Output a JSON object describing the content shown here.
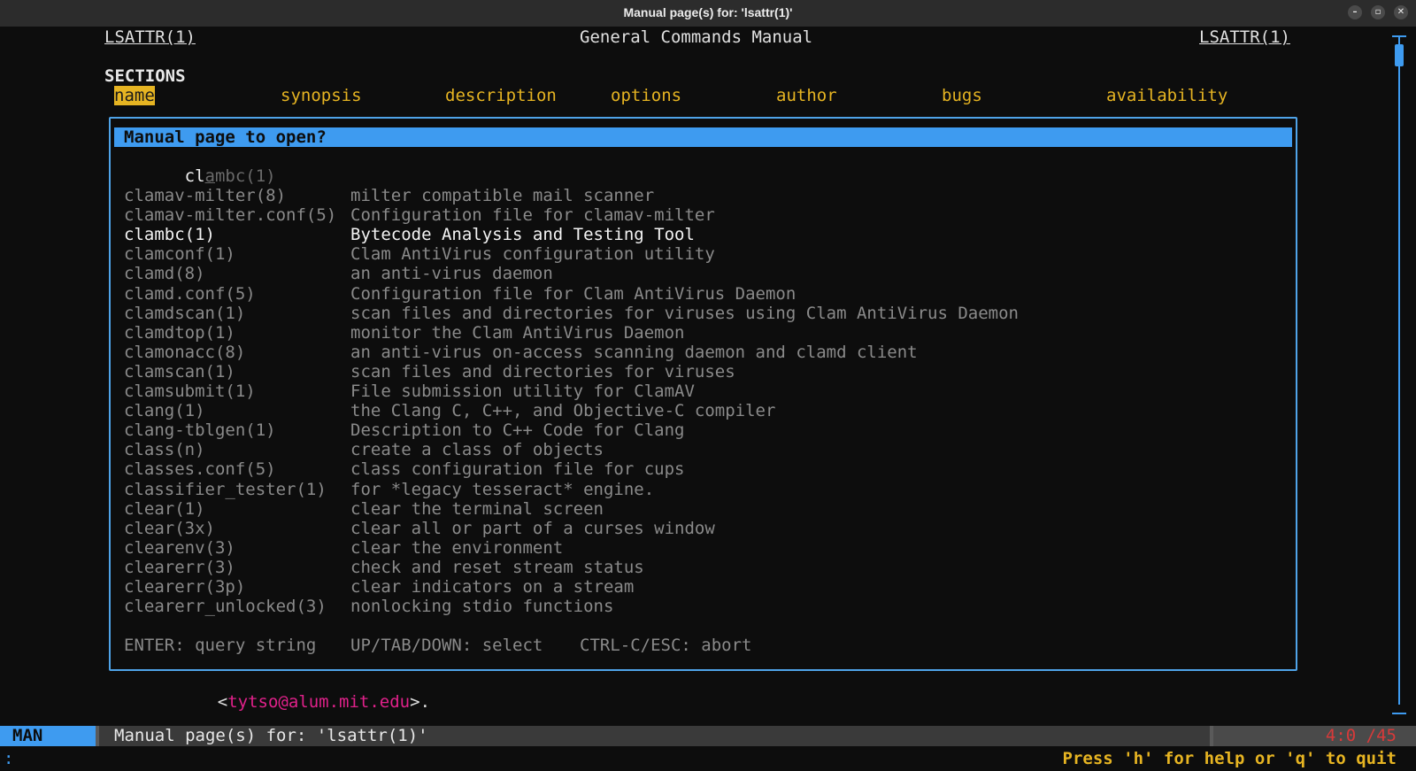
{
  "window": {
    "title": "Manual page(s) for: 'lsattr(1)'",
    "minimize_glyph": "–",
    "maximize_glyph": "▫",
    "close_glyph": "✕"
  },
  "header": {
    "left": "LSATTR(1)",
    "center": "General Commands Manual",
    "right": "LSATTR(1)"
  },
  "sections": {
    "title": "SECTIONS",
    "links": [
      "name",
      "synopsis",
      "description",
      "options",
      "author",
      "bugs",
      "availability"
    ],
    "active": "name"
  },
  "popup": {
    "prompt": "Manual page to open?",
    "input_typed": "cl",
    "input_suggest_underlined": "a",
    "input_suggest_rest": "mbc(1)",
    "results": [
      {
        "name": "clamav-milter(8)",
        "desc": "milter compatible mail scanner"
      },
      {
        "name": "clamav-milter.conf(5)",
        "desc": "Configuration file for clamav-milter"
      },
      {
        "name": "clambc(1)",
        "desc": "Bytecode Analysis and Testing Tool",
        "selected": true
      },
      {
        "name": "clamconf(1)",
        "desc": "Clam AntiVirus configuration utility"
      },
      {
        "name": "clamd(8)",
        "desc": "an anti-virus daemon"
      },
      {
        "name": "clamd.conf(5)",
        "desc": "Configuration file for Clam AntiVirus Daemon"
      },
      {
        "name": "clamdscan(1)",
        "desc": "scan files and directories for viruses using Clam AntiVirus Daemon"
      },
      {
        "name": "clamdtop(1)",
        "desc": "monitor the Clam AntiVirus Daemon"
      },
      {
        "name": "clamonacc(8)",
        "desc": "an anti-virus on-access scanning daemon and clamd client"
      },
      {
        "name": "clamscan(1)",
        "desc": "scan files and directories for viruses"
      },
      {
        "name": "clamsubmit(1)",
        "desc": "File submission utility for ClamAV"
      },
      {
        "name": "clang(1)",
        "desc": "the Clang C, C++, and Objective-C compiler"
      },
      {
        "name": "clang-tblgen(1)",
        "desc": "Description to C++ Code for Clang"
      },
      {
        "name": "class(n)",
        "desc": "create a class of objects"
      },
      {
        "name": "classes.conf(5)",
        "desc": "class configuration file for cups"
      },
      {
        "name": "classifier_tester(1)",
        "desc": "for *legacy tesseract* engine."
      },
      {
        "name": "clear(1)",
        "desc": "clear the terminal screen"
      },
      {
        "name": "clear(3x)",
        "desc": "clear all or part of a curses window"
      },
      {
        "name": "clearenv(3)",
        "desc": "clear the environment"
      },
      {
        "name": "clearerr(3)",
        "desc": "check and reset stream status"
      },
      {
        "name": "clearerr(3p)",
        "desc": "clear indicators on a stream"
      },
      {
        "name": "clearerr_unlocked(3)",
        "desc": "nonlocking stdio functions"
      }
    ],
    "hints": [
      "ENTER: query string",
      "UP/TAB/DOWN: select",
      "CTRL-C/ESC: abort"
    ]
  },
  "body_line": {
    "open": "<",
    "email": "tytso@alum.mit.edu",
    "close": ">."
  },
  "statusbar": {
    "mode": "MAN",
    "text": "Manual page(s) for: 'lsattr(1)'",
    "position": "4:0 /45"
  },
  "cmdline": {
    "prompt": ":",
    "help": "Press 'h' for help or 'q' to quit"
  },
  "colors": {
    "accent": "#3e9bf0",
    "section_link": "#e6b422",
    "email": "#e0218a",
    "position": "#d83a3a"
  }
}
